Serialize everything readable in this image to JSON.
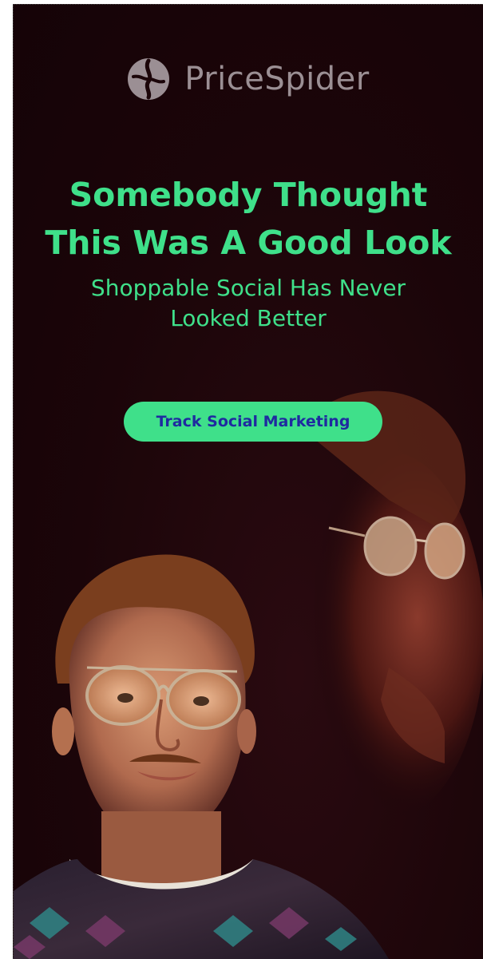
{
  "brand": {
    "name": "PriceSpider",
    "icon": "pricespider-logo-icon"
  },
  "headline": {
    "line1": "Somebody Thought",
    "line2": "This Was A Good Look"
  },
  "subhead": {
    "line1": "Shoppable Social Has Never",
    "line2": "Looked Better"
  },
  "cta": {
    "label": "Track Social Marketing"
  },
  "colors": {
    "background": "#1b0509",
    "accent": "#3fe08a",
    "cta_text": "#1f2aa0",
    "logo": "#9b8f94"
  },
  "image": {
    "subject": "two-men-in-tinted-aviator-glasses"
  }
}
